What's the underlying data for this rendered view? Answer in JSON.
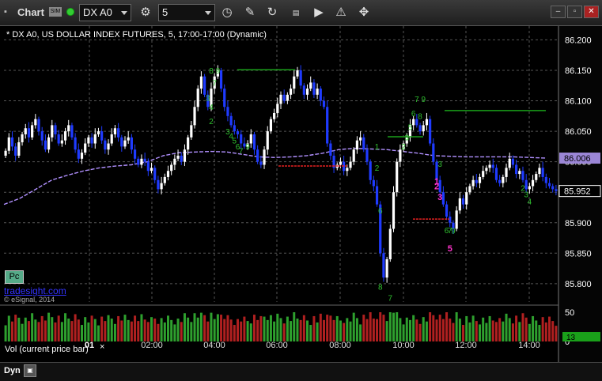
{
  "window": {
    "title": "Chart",
    "sim_label": "SIM",
    "symbol": "DX A0",
    "interval": "5"
  },
  "overlay": {
    "chart_title": "* DX A0, US DOLLAR INDEX FUTURES, 5, 17:00-17:00 (Dynamic)",
    "pc_label": "Pc",
    "brand": "tradesight.com",
    "copyright": "© eSignal, 2014",
    "vol_label": "Vol (current price bar)",
    "vol_close": "×",
    "dyn_label": "Dyn",
    "dyn_button": "▣"
  },
  "colors": {
    "bg": "#000000",
    "up": "#ffffff",
    "down": "#1f3bff",
    "ma": "#b190ff",
    "grid": "#555555",
    "green_line": "#1aa01a",
    "red_line": "#e02020",
    "green_text": "#2fbf2f",
    "magenta_text": "#ff33cc"
  },
  "chart_data": [
    {
      "type": "candlestick",
      "title": "* DX A0, US DOLLAR INDEX FUTURES, 5, 17:00-17:00 (Dynamic)",
      "x_ticks": [
        "01",
        "02:00",
        "04:00",
        "06:00",
        "08:00",
        "10:00",
        "12:00",
        "14:00"
      ],
      "y_ticks": [
        "86.200",
        "86.150",
        "86.100",
        "86.050",
        "86.000",
        "85.950",
        "85.900",
        "85.850",
        "85.800"
      ],
      "ylim": [
        85.77,
        86.22
      ],
      "grid": true,
      "last_price": "85.952",
      "ma_value": "86.006",
      "closes": [
        86.018,
        86.04,
        86.025,
        86.01,
        86.032,
        86.045,
        86.055,
        86.04,
        86.06,
        86.07,
        86.05,
        86.035,
        86.02,
        86.04,
        86.06,
        86.045,
        86.03,
        86.035,
        86.05,
        86.06,
        86.04,
        86.02,
        86.005,
        86.015,
        86.03,
        86.04,
        86.03,
        86.045,
        86.05,
        86.035,
        86.02,
        86.03,
        86.045,
        86.055,
        86.04,
        86.025,
        86.035,
        86.04,
        86.02,
        86.005,
        85.995,
        86.005,
        86.0,
        85.985,
        85.99,
        85.97,
        85.955,
        85.965,
        85.975,
        85.985,
        85.995,
        86.005,
        86.01,
        86.0,
        86.02,
        86.04,
        86.06,
        86.09,
        86.12,
        86.14,
        86.11,
        86.09,
        86.12,
        86.14,
        86.15,
        86.12,
        86.09,
        86.075,
        86.06,
        86.05,
        86.045,
        86.03,
        86.025,
        86.03,
        86.045,
        86.02,
        86.0,
        85.995,
        86.02,
        86.05,
        86.07,
        86.08,
        86.095,
        86.11,
        86.1,
        86.11,
        86.12,
        86.14,
        86.15,
        86.125,
        86.11,
        86.12,
        86.13,
        86.11,
        86.12,
        86.1,
        86.09,
        86.03,
        86.01,
        85.99,
        85.995,
        86.0,
        85.985,
        85.99,
        86.0,
        86.02,
        86.035,
        86.04,
        86.02,
        86.0,
        85.97,
        85.96,
        85.93,
        85.85,
        85.81,
        85.84,
        85.89,
        85.95,
        86.0,
        86.02,
        86.03,
        86.04,
        86.06,
        86.07,
        86.06,
        86.05,
        86.06,
        86.07,
        86.03,
        86.0,
        85.97,
        85.95,
        85.93,
        85.91,
        85.9,
        85.89,
        85.92,
        85.94,
        85.93,
        85.95,
        85.96,
        85.97,
        85.965,
        85.975,
        85.985,
        85.99,
        85.995,
        85.99,
        85.97,
        85.965,
        85.975,
        85.99,
        86.005,
        85.995,
        85.98,
        85.985,
        85.97,
        85.955,
        85.96,
        85.97,
        85.98,
        85.99,
        85.975,
        85.965,
        85.96,
        85.955,
        85.952
      ],
      "moving_average": [
        85.93,
        85.94,
        85.955,
        85.97,
        85.978,
        85.985,
        85.99,
        85.993,
        85.995,
        86.0,
        86.01,
        86.015,
        86.016,
        86.017,
        86.016,
        86.012,
        86.008,
        86.007,
        86.008,
        86.01,
        86.014,
        86.02,
        86.022,
        86.021,
        86.02,
        86.017,
        86.014,
        86.01,
        86.009,
        86.008,
        86.008,
        86.008,
        86.008,
        86.007,
        86.006
      ],
      "horizontal_levels": [
        {
          "x_from": 300,
          "x_to": 373,
          "y": 86.151,
          "color": "green"
        },
        {
          "x_from": 352,
          "x_to": 440,
          "y": 85.993,
          "color": "red"
        },
        {
          "x_from": 490,
          "x_to": 535,
          "y": 86.041,
          "color": "green"
        },
        {
          "x_from": 562,
          "x_to": 690,
          "y": 86.084,
          "color": "green"
        },
        {
          "x_from": 522,
          "x_to": 568,
          "y": 85.906,
          "color": "red"
        }
      ],
      "annotations": [
        {
          "t": "8",
          "xi": 62,
          "y": 86.145,
          "c": "g"
        },
        {
          "t": "9",
          "xi": 64,
          "y": 86.145,
          "c": "g"
        },
        {
          "t": "7",
          "xi": 63,
          "y": 86.125,
          "c": "g"
        },
        {
          "t": "3",
          "xi": 61,
          "y": 86.1,
          "c": "g"
        },
        {
          "t": "4",
          "xi": 62,
          "y": 86.085,
          "c": "g"
        },
        {
          "t": "2",
          "xi": 62,
          "y": 86.062,
          "c": "g"
        },
        {
          "t": "3",
          "xi": 67,
          "y": 86.045,
          "c": "g"
        },
        {
          "t": "4",
          "xi": 68,
          "y": 86.038,
          "c": "g"
        },
        {
          "t": "5",
          "xi": 69,
          "y": 86.03,
          "c": "g"
        },
        {
          "t": "6",
          "xi": 70,
          "y": 86.02,
          "c": "g"
        },
        {
          "t": "7",
          "xi": 71,
          "y": 86.013,
          "c": "g"
        },
        {
          "t": "9",
          "xi": 73,
          "y": 86.02,
          "c": "g"
        },
        {
          "t": "7",
          "xi": 124,
          "y": 86.098,
          "c": "g"
        },
        {
          "t": "9",
          "xi": 126,
          "y": 86.098,
          "c": "g"
        },
        {
          "t": "6",
          "xi": 123,
          "y": 86.075,
          "c": "g"
        },
        {
          "t": "8",
          "xi": 125,
          "y": 86.07,
          "c": "g"
        },
        {
          "t": "5",
          "xi": 122,
          "y": 86.052,
          "c": "g"
        },
        {
          "t": "3",
          "xi": 121,
          "y": 86.035,
          "c": "g"
        },
        {
          "t": "2",
          "xi": 120,
          "y": 86.02,
          "c": "g"
        },
        {
          "t": "1",
          "xi": 130,
          "y": 85.963,
          "c": "m"
        },
        {
          "t": "2",
          "xi": 130,
          "y": 85.955,
          "c": "m"
        },
        {
          "t": "3",
          "xi": 131,
          "y": 85.937,
          "c": "m"
        },
        {
          "t": "3",
          "xi": 131,
          "y": 85.992,
          "c": "g"
        },
        {
          "t": "5",
          "xi": 134,
          "y": 85.853,
          "c": "m"
        },
        {
          "t": "6",
          "xi": 133,
          "y": 85.883,
          "c": "g"
        },
        {
          "t": "7",
          "xi": 134,
          "y": 85.883,
          "c": "g"
        },
        {
          "t": "9",
          "xi": 135,
          "y": 85.882,
          "c": "g"
        },
        {
          "t": "1",
          "xi": 112,
          "y": 86.02,
          "c": "g"
        },
        {
          "t": "2",
          "xi": 112,
          "y": 85.985,
          "c": "g"
        },
        {
          "t": "6",
          "xi": 113,
          "y": 85.915,
          "c": "g"
        },
        {
          "t": "8",
          "xi": 113,
          "y": 85.79,
          "c": "g"
        },
        {
          "t": "7",
          "xi": 116,
          "y": 85.772,
          "c": "g"
        },
        {
          "t": "2",
          "xi": 156,
          "y": 85.952,
          "c": "g"
        },
        {
          "t": "3",
          "xi": 157,
          "y": 85.942,
          "c": "g"
        },
        {
          "t": "4",
          "xi": 158,
          "y": 85.93,
          "c": "g"
        }
      ],
      "volume": {
        "ylim": [
          0,
          60
        ],
        "y_ticks": [
          "50",
          "0"
        ],
        "last_value": "13"
      }
    }
  ]
}
